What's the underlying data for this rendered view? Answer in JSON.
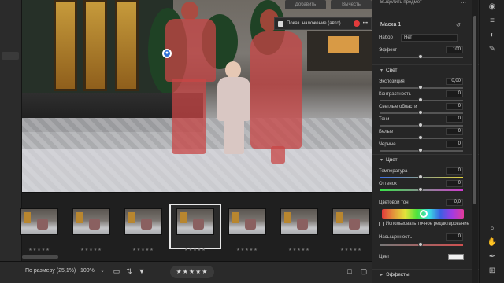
{
  "top_buttons": {
    "add": "Добавить",
    "subtract": "Вычесть",
    "select_subject": "Выделить предмет"
  },
  "overlay": {
    "label": "Показ. наложение (авто)",
    "more": "•••"
  },
  "mask": {
    "title": "Маска 1",
    "preset_label": "Набор",
    "preset_value": "Нет",
    "effect_label": "Эффект",
    "effect_value": "100"
  },
  "sections": {
    "light": {
      "title": "Свет",
      "rows": [
        {
          "label": "Экспозиция",
          "value": "0,00"
        },
        {
          "label": "Контрастность",
          "value": "0"
        },
        {
          "label": "Светлые области",
          "value": "0"
        },
        {
          "label": "Тени",
          "value": "0"
        },
        {
          "label": "Белые",
          "value": "0"
        },
        {
          "label": "Черные",
          "value": "0"
        }
      ]
    },
    "color": {
      "title": "Цвет",
      "rows": [
        {
          "label": "Температура",
          "value": "0"
        },
        {
          "label": "Оттенок",
          "value": "0"
        }
      ],
      "hue_label": "Цветовой тон",
      "hue_value": "0,0",
      "precise_label": "Использовать точное редактирование",
      "saturation_label": "Насыщенность",
      "saturation_value": "0",
      "color_label": "Цвет"
    },
    "effects": {
      "title": "Эффекты"
    }
  },
  "filmstrip": {
    "stars": "★★★★★",
    "selected_index": 3,
    "count": 7
  },
  "bottom": {
    "fit": "По размеру (25,1%)",
    "zoom": "100%",
    "rating": "★★★★★"
  },
  "colors": {
    "accent_blue": "#2d6fd6",
    "mask_red": "#c84646",
    "overlay_dot": "#e23b3b"
  },
  "icons": [
    "search-icon",
    "hand-icon",
    "grid-icon",
    "info-icon",
    "loupe-icon",
    "compare-icon",
    "filter-icon",
    "eye-icon",
    "mask-icon",
    "brush-icon"
  ]
}
